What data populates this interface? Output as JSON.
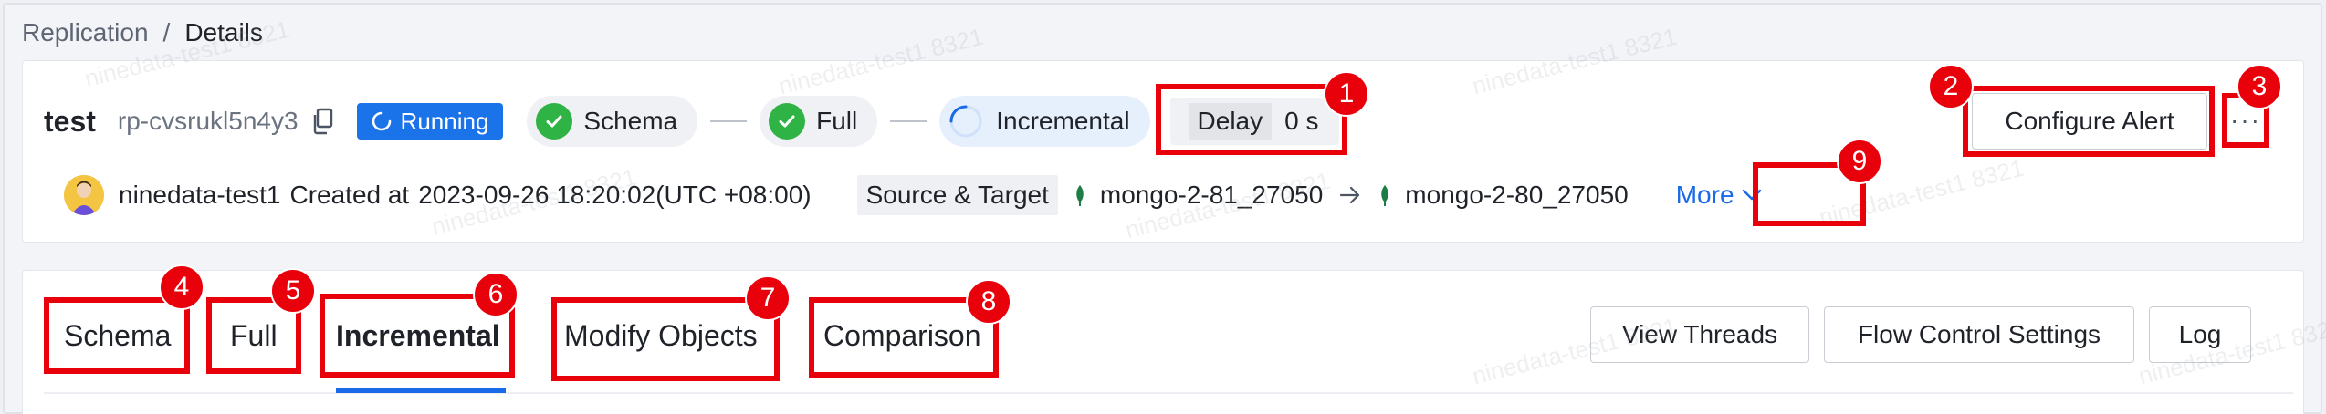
{
  "breadcrumb": {
    "parent": "Replication",
    "separator": "/",
    "current": "Details"
  },
  "task": {
    "name": "test",
    "id": "rp-cvsrukl5n4y3",
    "status": "Running",
    "stages": [
      {
        "label": "Schema",
        "state": "done"
      },
      {
        "label": "Full",
        "state": "done"
      },
      {
        "label": "Incremental",
        "state": "in-progress"
      }
    ],
    "delay": {
      "label": "Delay",
      "value": "0 s"
    },
    "owner": "ninedata-test1",
    "created_label": "Created at",
    "created_time": "2023-09-26 18:20:02(UTC +08:00)",
    "source_target_label": "Source & Target",
    "source": "mongo-2-81_27050",
    "target": "mongo-2-80_27050",
    "more_label": "More"
  },
  "header_actions": {
    "configure_alert": "Configure Alert",
    "more": "···"
  },
  "tabs": [
    {
      "label": "Schema"
    },
    {
      "label": "Full"
    },
    {
      "label": "Incremental",
      "active": true
    },
    {
      "label": "Modify Objects"
    },
    {
      "label": "Comparison"
    }
  ],
  "tab_actions": {
    "view_threads": "View Threads",
    "flow_control": "Flow Control Settings",
    "log": "Log"
  },
  "watermark": "ninedata-test1 8321",
  "annotations": [
    "1",
    "2",
    "3",
    "4",
    "5",
    "6",
    "7",
    "8",
    "9"
  ],
  "colors": {
    "primary": "#1a6ae8",
    "running": "#1a73e8",
    "success": "#2fb344",
    "annotation": "#e8000b",
    "mongo_leaf": "#1e7d45"
  }
}
